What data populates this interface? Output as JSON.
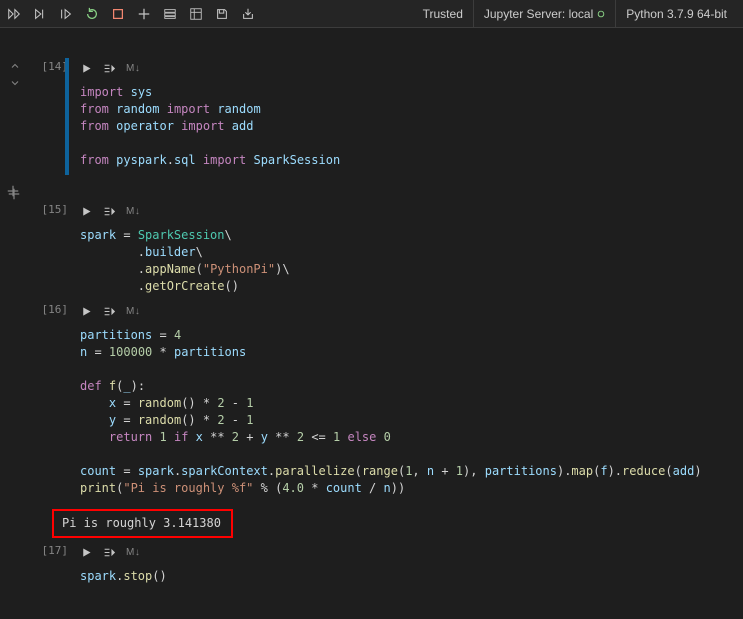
{
  "toolbar": {
    "trusted": "Trusted",
    "server": "Jupyter Server: local",
    "kernel": "Python 3.7.9 64-bit"
  },
  "cells": [
    {
      "exec": "[14]",
      "md": "M↓",
      "active": true,
      "code_html": "<span class=\"kw\">import</span> <span class=\"var\">sys</span>\n<span class=\"kw\">from</span> <span class=\"var\">random</span> <span class=\"kw\">import</span> <span class=\"var\">random</span>\n<span class=\"kw\">from</span> <span class=\"var\">operator</span> <span class=\"kw\">import</span> <span class=\"var\">add</span>\n\n<span class=\"kw\">from</span> <span class=\"var\">pyspark</span>.<span class=\"var\">sql</span> <span class=\"kw\">import</span> <span class=\"var\">SparkSession</span>"
    },
    {
      "exec": "[15]",
      "md": "M↓",
      "code_html": "<span class=\"var\">spark</span> = <span class=\"cls\">SparkSession</span>\\\n        .<span class=\"var\">builder</span>\\\n        .<span class=\"fn\">appName</span>(<span class=\"str\">\"PythonPi\"</span>)\\\n        .<span class=\"fn\">getOrCreate</span>()"
    },
    {
      "exec": "[16]",
      "md": "M↓",
      "code_html": "<span class=\"var\">partitions</span> = <span class=\"num\">4</span>\n<span class=\"var\">n</span> = <span class=\"num\">100000</span> * <span class=\"var\">partitions</span>\n\n<span class=\"kw\">def</span> <span class=\"fn\">f</span>(<span class=\"var\">_</span>):\n    <span class=\"var\">x</span> = <span class=\"fn\">random</span>() * <span class=\"num\">2</span> - <span class=\"num\">1</span>\n    <span class=\"var\">y</span> = <span class=\"fn\">random</span>() * <span class=\"num\">2</span> - <span class=\"num\">1</span>\n    <span class=\"kw\">return</span> <span class=\"num\">1</span> <span class=\"kw\">if</span> <span class=\"var\">x</span> ** <span class=\"num\">2</span> + <span class=\"var\">y</span> ** <span class=\"num\">2</span> &lt;= <span class=\"num\">1</span> <span class=\"kw\">else</span> <span class=\"num\">0</span>\n\n<span class=\"var\">count</span> = <span class=\"var\">spark</span>.<span class=\"var\">sparkContext</span>.<span class=\"fn\">parallelize</span>(<span class=\"fn\">range</span>(<span class=\"num\">1</span>, <span class=\"var\">n</span> + <span class=\"num\">1</span>), <span class=\"var\">partitions</span>).<span class=\"fn\">map</span>(<span class=\"var\">f</span>).<span class=\"fn\">reduce</span>(<span class=\"var\">add</span>)\n<span class=\"fn\">print</span>(<span class=\"str\">\"Pi is roughly %f\"</span> % (<span class=\"num\">4.0</span> * <span class=\"var\">count</span> / <span class=\"var\">n</span>))",
      "output": "Pi is roughly 3.141380",
      "output_highlighted": true
    },
    {
      "exec": "[17]",
      "md": "M↓",
      "code_html": "<span class=\"var\">spark</span>.<span class=\"fn\">stop</span>()"
    }
  ]
}
